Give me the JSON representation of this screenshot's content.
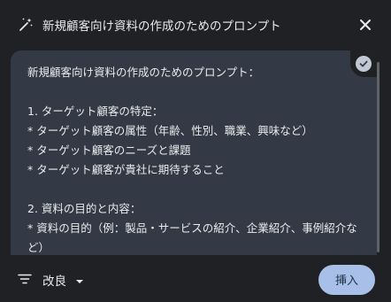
{
  "header": {
    "title": "新規顧客向け資料の作成のためのプロンプト",
    "icon": "magic-wand-sparkle-icon",
    "close_icon": "close-icon"
  },
  "content": {
    "text": "新規顧客向け資料の作成のためのプロンプト：\n\n1. ターゲット顧客の特定：\n* ターゲット顧客の属性（年齢、性別、職業、興味など）\n* ターゲット顧客のニーズと課題\n* ターゲット顧客が貴社に期待すること\n\n2. 資料の目的と内容：\n* 資料の目的（例：製品・サービスの紹介、企業紹介、事例紹介など）\n* 資料の内容（例：製品・サービスの詳細、企業の強み、顧客の",
    "badge_icon": "check-circle-icon"
  },
  "footer": {
    "refine_label": "改良",
    "refine_icon": "filter-list-icon",
    "dropdown_icon": "caret-down-icon",
    "insert_label": "挿入"
  }
}
